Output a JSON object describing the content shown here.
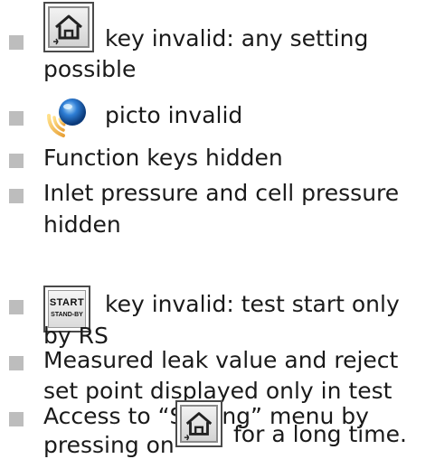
{
  "items": [
    {
      "icon": "home-key-icon",
      "line1": "key invalid: any setting",
      "line2": "possible"
    },
    {
      "icon": "audio-picto-icon",
      "line1": "picto invalid"
    },
    {
      "line1": "Function keys hidden"
    },
    {
      "line1": "Inlet pressure and cell pressure",
      "line2": "hidden"
    },
    {
      "icon": "start-standby-key-icon",
      "key_top": "START",
      "key_bottom": "STAND-BY",
      "line1": "key invalid: test start only",
      "line2": "by RS"
    },
    {
      "line1": "Measured leak value and reject",
      "line2": "set point displayed only in test"
    },
    {
      "line1": "Access to “Setting” menu by",
      "line2_before": "pressing on",
      "line2_icon": "home-key-icon",
      "line2_after": "for a long time."
    }
  ],
  "colors": {
    "bullet": "#bdbdbd",
    "text": "#1a1a1a",
    "key_border": "#4a4a4a"
  }
}
